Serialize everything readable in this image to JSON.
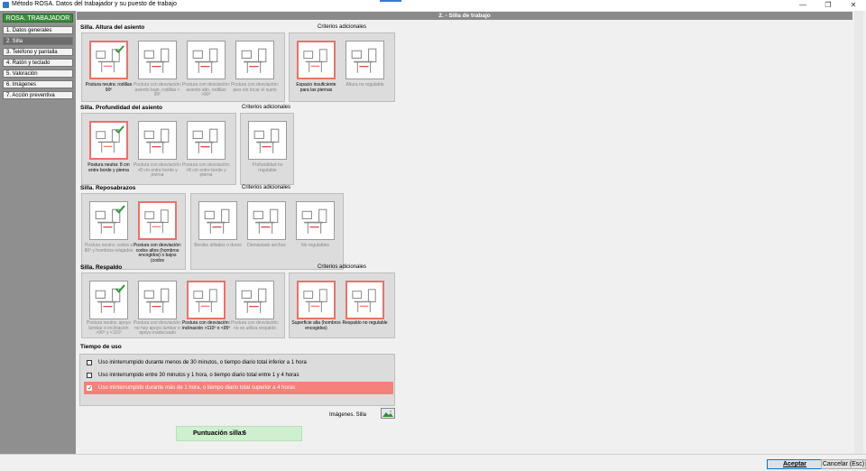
{
  "window": {
    "title": "Método ROSA. Datos del trabajador y su puesto de trabajo",
    "minimize": "—",
    "restore": "❐",
    "close": "✕"
  },
  "sidebar": {
    "header": "ROSA. TRABAJADOR",
    "items": [
      {
        "label": "1. Datos generales"
      },
      {
        "label": "2. Silla"
      },
      {
        "label": "3. Teléfono y pantalla"
      },
      {
        "label": "4. Ratón y teclado"
      },
      {
        "label": "5. Valoración"
      },
      {
        "label": "6. Imágenes"
      },
      {
        "label": "7. Acción preventiva"
      }
    ]
  },
  "header": "2. - Silla de trabajo",
  "sections": {
    "altura": {
      "title": "Silla. Altura del asiento",
      "criteria_title": "Criterios adicionales",
      "options": [
        {
          "caption": "Postura neutra: rodillas 90º",
          "selected": true,
          "marker": "check"
        },
        {
          "caption": "Postura con desviación: asiento bajo, rodillas < 90º",
          "selected": false,
          "marker": "< 90º"
        },
        {
          "caption": "Postura con desviación: asiento alto, rodillas >90º",
          "selected": false,
          "marker": "> 90º"
        },
        {
          "caption": "Postura con desviación: pies sin tocar el suelo",
          "selected": false,
          "marker": ""
        }
      ],
      "criteria": [
        {
          "caption": "Espacio insuficiente para las piernas",
          "selected": true
        },
        {
          "caption": "Altura no regulable",
          "selected": false
        }
      ]
    },
    "profundidad": {
      "title": "Silla. Profundidad del asiento",
      "criteria_title": "Criterios adicionales",
      "options": [
        {
          "caption": "Postura neutra: 8 cm entre borde y pierna",
          "selected": true,
          "marker": "check"
        },
        {
          "caption": "Postura con desviación: >8 cm entre borde y pierna",
          "selected": false,
          "marker": ""
        },
        {
          "caption": "Postura con desviación: >8 cm entre borde y pierna",
          "selected": false,
          "marker": ""
        }
      ],
      "criteria": [
        {
          "caption": "Profundidad no regulable",
          "selected": false
        }
      ]
    },
    "reposabrazos": {
      "title": "Silla. Reposabrazos",
      "criteria_title": "Criterios adicionales",
      "options": [
        {
          "caption": "Postura neutra: codos a 90º y hombros relajados",
          "selected": false,
          "marker": "check"
        },
        {
          "caption": "Postura con desviación: codos altos (hombros encogidos) o bajos (codos",
          "selected": true,
          "marker": ""
        }
      ],
      "criteria": [
        {
          "caption": "Bordes afilados o duros",
          "selected": false
        },
        {
          "caption": "Demasiado anchos",
          "selected": false
        },
        {
          "caption": "No regulables",
          "selected": false
        }
      ]
    },
    "respaldo": {
      "title": "Silla. Respaldo",
      "criteria_title": "Criterios adicionales",
      "options": [
        {
          "caption": "Postura neutra: apoyo lumbar e inclinación >90º y <110º",
          "selected": false,
          "marker": "check"
        },
        {
          "caption": "Postura con desviación: no hay apoyo lumbar o apoyo inadecuado",
          "selected": false,
          "marker": ""
        },
        {
          "caption": "Postura con desviación: inclinación >110º o <95º",
          "selected": true,
          "marker": "> 110º o < 95º"
        },
        {
          "caption": "Postura con desviación: no se utiliza respaldo",
          "selected": false,
          "marker": ""
        }
      ],
      "criteria": [
        {
          "caption": "Superficie alta (hombros encogidos)",
          "selected": true
        },
        {
          "caption": "Respaldo no regulable",
          "selected": true
        }
      ]
    }
  },
  "tiempo": {
    "title": "Tiempo de uso",
    "options": [
      {
        "label": "Uso ininterrumpido durante menos de 30 minutos,  o tiempo diario total inferior a 1 hora",
        "checked": false
      },
      {
        "label": "Uso ininterrumpido entre 30 minutos y 1 hora,  o tiempo diario total entre 1 y 4 horas",
        "checked": false
      },
      {
        "label": "Uso ininterrumpido durante más de 1 hora,  o tiempo diario total superior a 4 horas",
        "checked": true
      }
    ]
  },
  "images_label": "Imágenes. Silla",
  "score": {
    "label": "Puntuación silla:",
    "value": "6"
  },
  "footer": {
    "accept": "Aceptar",
    "cancel": "Cancelar (Esc)"
  },
  "colors": {
    "selected_border": "#e8736a",
    "selected_row": "#f4817a",
    "check": "#2e9b3a",
    "sidebar_header": "#3c8c3c",
    "score_bg": "#cff0cf"
  }
}
